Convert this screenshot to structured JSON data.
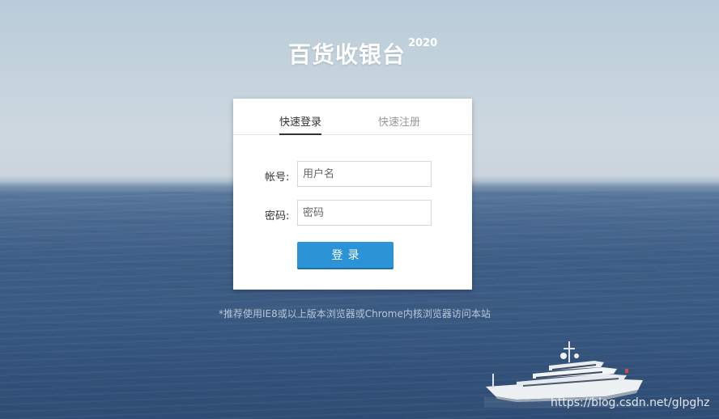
{
  "app": {
    "title": "百货收银台",
    "year": "2020"
  },
  "tabs": [
    {
      "label": "快速登录",
      "active": true
    },
    {
      "label": "快速注册",
      "active": false
    }
  ],
  "form": {
    "username": {
      "label": "帐号:",
      "placeholder": "用户名",
      "value": ""
    },
    "password": {
      "label": "密码:",
      "placeholder": "密码",
      "value": ""
    },
    "submit_label": "登录"
  },
  "notice": "*推荐使用IE8或以上版本浏览器或Chrome内核浏览器访问本站",
  "watermark": "https://blog.csdn.net/glpghz",
  "colors": {
    "accent": "#2b93d6",
    "panel": "#ffffff",
    "sea": "#3e5e86"
  },
  "icons": {
    "background": "sea-yacht-photo"
  }
}
